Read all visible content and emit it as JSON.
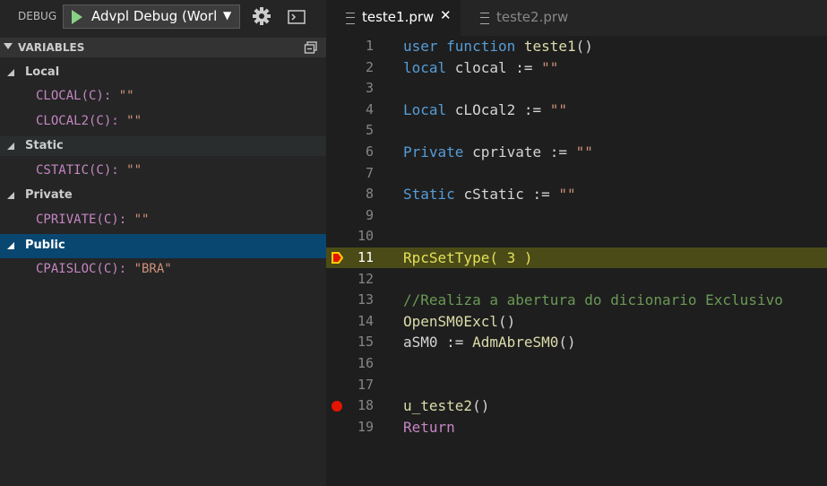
{
  "debug": {
    "label": "DEBUG",
    "config_name": "Advpl Debug (Worl",
    "caret": "▼"
  },
  "variables": {
    "title": "VARIABLES",
    "scopes": [
      {
        "name": "Local",
        "vars": [
          {
            "name": "CLOCAL(C): ",
            "value": "\"\""
          },
          {
            "name": "CLOCAL2(C): ",
            "value": "\"\""
          }
        ]
      },
      {
        "name": "Static",
        "vars": [
          {
            "name": "CSTATIC(C): ",
            "value": "\"\""
          }
        ]
      },
      {
        "name": "Private",
        "vars": [
          {
            "name": "CPRIVATE(C): ",
            "value": "\"\""
          }
        ]
      },
      {
        "name": "Public",
        "vars": [
          {
            "name": "CPAISLOC(C): ",
            "value": "\"BRA\""
          }
        ]
      }
    ]
  },
  "tabs": [
    {
      "name": "teste1.prw",
      "close": "✕"
    },
    {
      "name": "teste2.prw"
    }
  ],
  "editor": {
    "lines": [
      {
        "n": "1",
        "tokens": [
          {
            "t": "user function ",
            "c": "kw"
          },
          {
            "t": "teste1",
            "c": "fn"
          },
          {
            "t": "()",
            "c": ""
          }
        ]
      },
      {
        "n": "2",
        "tokens": [
          {
            "t": "local ",
            "c": "kw"
          },
          {
            "t": "clocal := ",
            "c": ""
          },
          {
            "t": "\"\"",
            "c": "str"
          }
        ]
      },
      {
        "n": "3",
        "tokens": []
      },
      {
        "n": "4",
        "tokens": [
          {
            "t": "Local ",
            "c": "kw"
          },
          {
            "t": "cLOcal2 := ",
            "c": ""
          },
          {
            "t": "\"\"",
            "c": "str"
          }
        ]
      },
      {
        "n": "5",
        "tokens": []
      },
      {
        "n": "6",
        "tokens": [
          {
            "t": "Private ",
            "c": "kw"
          },
          {
            "t": "cprivate := ",
            "c": ""
          },
          {
            "t": "\"\"",
            "c": "str"
          }
        ]
      },
      {
        "n": "7",
        "tokens": []
      },
      {
        "n": "8",
        "tokens": [
          {
            "t": "Static ",
            "c": "kw"
          },
          {
            "t": "cStatic := ",
            "c": ""
          },
          {
            "t": "\"\"",
            "c": "str"
          }
        ]
      },
      {
        "n": "9",
        "tokens": []
      },
      {
        "n": "10",
        "tokens": []
      },
      {
        "n": "11",
        "tokens": [
          {
            "t": "RpcSetType( 3 )",
            "c": ""
          }
        ]
      },
      {
        "n": "12",
        "tokens": []
      },
      {
        "n": "13",
        "tokens": [
          {
            "t": "//Realiza a abertura do dicionario Exclusivo",
            "c": "cmt"
          }
        ]
      },
      {
        "n": "14",
        "tokens": [
          {
            "t": "OpenSM0Excl",
            "c": "fn"
          },
          {
            "t": "()",
            "c": ""
          }
        ]
      },
      {
        "n": "15",
        "tokens": [
          {
            "t": "aSM0 := ",
            "c": ""
          },
          {
            "t": "AdmAbreSM0",
            "c": "fn"
          },
          {
            "t": "()",
            "c": ""
          }
        ]
      },
      {
        "n": "16",
        "tokens": []
      },
      {
        "n": "17",
        "tokens": []
      },
      {
        "n": "18",
        "tokens": [
          {
            "t": "u_teste2",
            "c": "fn"
          },
          {
            "t": "()",
            "c": ""
          }
        ]
      },
      {
        "n": "19",
        "tokens": [
          {
            "t": "Return",
            "c": "ctl"
          }
        ]
      }
    ],
    "current_line": "11",
    "breakpoint_lines": [
      "11",
      "18"
    ],
    "colors": {
      "breakpoint": "#e51400",
      "stopped_line_bg": "#4b4b18",
      "keyword": "#569cd6",
      "string": "#ce9178",
      "comment": "#6a9955"
    }
  }
}
